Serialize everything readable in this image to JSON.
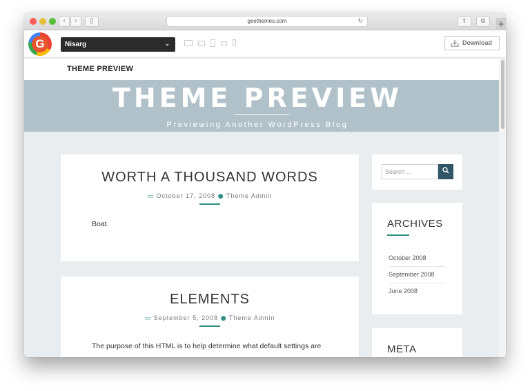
{
  "browser": {
    "url": "geethemes.com",
    "icons": [
      "back-icon",
      "forward-icon",
      "sidebar-icon",
      "reload-icon",
      "share-icon",
      "tabs-icon",
      "new-tab-icon"
    ],
    "traffic_lights": {
      "close": "#fc5b57",
      "minimize": "#e5bf3c",
      "zoom": "#57c038"
    }
  },
  "toolbar": {
    "theme_select": "Nisarg",
    "download_label": "Download",
    "devices": [
      "desktop-icon",
      "laptop-icon",
      "tablet-portrait-icon",
      "tablet-landscape-icon",
      "mobile-icon"
    ]
  },
  "site": {
    "title": "THEME PREVIEW",
    "hero_title": "THEME PREVIEW",
    "hero_subtitle": "Previewing Another WordPress Blog",
    "hero_bg": "#b1c1c9",
    "accent": "#2f8f83"
  },
  "posts": [
    {
      "title": "WORTH A THOUSAND WORDS",
      "date": "October 17, 2008",
      "author": "Theme Admin",
      "body": "Boat."
    },
    {
      "title": "ELEMENTS",
      "date": "September 5, 2008",
      "author": "Theme Admin",
      "body": "The purpose of this HTML is to help determine what default settings are"
    }
  ],
  "sidebar": {
    "search_placeholder": "Search ...",
    "archives_title": "ARCHIVES",
    "archives": [
      "October 2008",
      "September 2008",
      "June 2008"
    ],
    "meta_title": "META"
  }
}
